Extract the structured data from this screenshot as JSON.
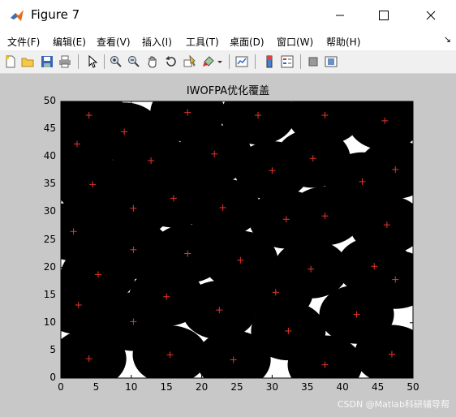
{
  "window": {
    "title": "Figure 7"
  },
  "menu": {
    "items": [
      "文件(F)",
      "编辑(E)",
      "查看(V)",
      "插入(I)",
      "工具(T)",
      "桌面(D)",
      "窗口(W)",
      "帮助(H)"
    ]
  },
  "toolbar": {
    "icons": [
      "new-file-icon",
      "open-folder-icon",
      "save-icon",
      "print-icon",
      "pointer-icon",
      "zoom-in-icon",
      "zoom-out-icon",
      "pan-icon",
      "rotate-icon",
      "data-cursor-icon",
      "brush-icon",
      "link-plot-icon",
      "colorbar-icon",
      "legend-icon",
      "hide-plot-tools-icon",
      "show-plot-tools-icon"
    ]
  },
  "chart_data": {
    "type": "scatter",
    "title": "IWOFPA优化覆盖",
    "xlim": [
      0,
      50
    ],
    "ylim": [
      0,
      50
    ],
    "xticks": [
      0,
      5,
      10,
      15,
      20,
      25,
      30,
      35,
      40,
      45,
      50
    ],
    "yticks": [
      0,
      5,
      10,
      15,
      20,
      25,
      30,
      35,
      40,
      45,
      50
    ],
    "sensing_radius": 5.3,
    "coverage_color": "#000000",
    "marker_color": "#e8352c",
    "marker": "+",
    "points": [
      [
        4,
        47.5
      ],
      [
        9,
        44.5
      ],
      [
        18,
        48
      ],
      [
        28,
        47.5
      ],
      [
        37.5,
        47.5
      ],
      [
        46,
        46.5
      ],
      [
        2.3,
        42.3
      ],
      [
        12.8,
        39.3
      ],
      [
        21.8,
        40.5
      ],
      [
        30,
        37.5
      ],
      [
        35.8,
        39.7
      ],
      [
        47.5,
        37.7
      ],
      [
        4.5,
        35
      ],
      [
        16,
        32.5
      ],
      [
        23,
        30.8
      ],
      [
        42.8,
        35.5
      ],
      [
        10.3,
        30.7
      ],
      [
        32,
        28.7
      ],
      [
        37.5,
        29.3
      ],
      [
        46.3,
        27.7
      ],
      [
        1.8,
        26.5
      ],
      [
        10.3,
        23.2
      ],
      [
        18,
        22.5
      ],
      [
        25.5,
        21.3
      ],
      [
        35.5,
        19.7
      ],
      [
        44.5,
        20.2
      ],
      [
        5.3,
        18.7
      ],
      [
        47.5,
        17.8
      ],
      [
        15,
        14.7
      ],
      [
        30.5,
        15.5
      ],
      [
        2.5,
        13.2
      ],
      [
        22.5,
        12.3
      ],
      [
        42,
        11.5
      ],
      [
        10.3,
        10.2
      ],
      [
        32.3,
        8.5
      ],
      [
        4,
        3.5
      ],
      [
        15.5,
        4.2
      ],
      [
        24.5,
        3.3
      ],
      [
        37.5,
        2.4
      ],
      [
        47,
        4.3
      ]
    ]
  },
  "watermark": "CSDN @Matlab科研辅导帮"
}
